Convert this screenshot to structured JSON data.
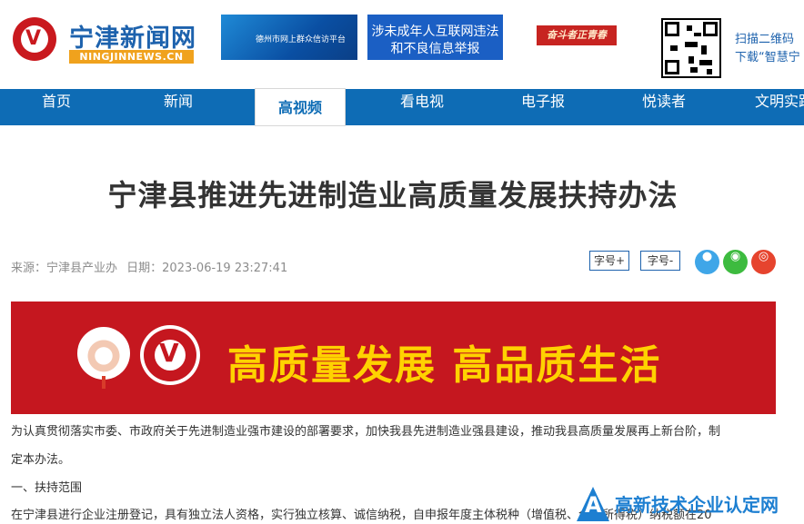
{
  "header": {
    "logo_text": "宁津新闻网",
    "logo_domain": "NINGJINNEWS.CN",
    "banner_1_text": "德州市网上群众信访平台",
    "banner_2_line1": "涉未成年人互联网违法",
    "banner_2_line2": "和不良信息举报",
    "banner_3_text": "奋斗者正青春",
    "qr_line1": "扫描二维码",
    "qr_line2": "下载“智慧宁"
  },
  "nav": {
    "items": [
      "首页",
      "新闻",
      "高视频",
      "看电视",
      "电子报",
      "悦读者",
      "文明实践"
    ],
    "active": "高视频"
  },
  "article": {
    "title": "宁津县推进先进制造业高质量发展扶持办法",
    "source": "来源：宁津县产业办",
    "date": "日期：2023-06-19 23:27:41",
    "font_larger": "字号+",
    "font_smaller": "字号-",
    "hero_text": "高质量发展 高品质生活",
    "para1_line1": "为认真贯彻落实市委、市政府关于先进制造业强市建设的部署要求，加快我县先进制造业强县建设，推动我县高质量发展再上新台阶，制",
    "para1_line2": "定本办法。",
    "section1": "一、扶持范围",
    "para2": "在宁津县进行企业注册登记，具有独立法人资格，实行独立核算、诚信纳税，自申报年度主体税种（增值税、企业所得税）纳税额在20"
  },
  "watermark": {
    "text": "高新技术企业认定网"
  },
  "colors": {
    "brand_blue": "#0e6cb5",
    "brand_red": "#c5171f",
    "hero_yellow": "#ffd200",
    "share_qq": "#3fa6e8",
    "share_wechat": "#3dbb3f",
    "share_weibo": "#e6442e"
  }
}
